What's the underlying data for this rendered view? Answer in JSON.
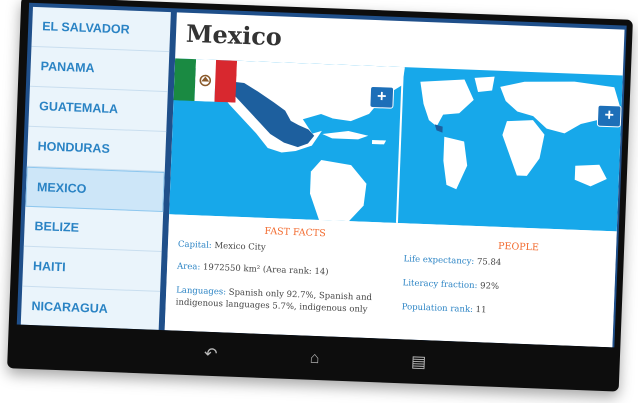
{
  "sidebar": {
    "items": [
      {
        "label": "EL SALVADOR"
      },
      {
        "label": "PANAMA"
      },
      {
        "label": "GUATEMALA"
      },
      {
        "label": "HONDURAS"
      },
      {
        "label": "MEXICO",
        "selected": true
      },
      {
        "label": "BELIZE"
      },
      {
        "label": "HAITI"
      },
      {
        "label": "NICARAGUA"
      }
    ]
  },
  "country": {
    "title": "Mexico",
    "fast_facts": {
      "heading": "FAST FACTS",
      "capital_label": "Capital:",
      "capital_value": "Mexico City",
      "area_label": "Area:",
      "area_value": "1972550 km² (Area rank: 14)",
      "languages_label": "Languages:",
      "languages_value": "Spanish only 92.7%, Spanish and indigenous languages 5.7%, indigenous only"
    },
    "people": {
      "heading": "PEOPLE",
      "life_label": "Life expectancy:",
      "life_value": "75.84",
      "literacy_label": "Literacy fraction:",
      "literacy_value": "92%",
      "population_label": "Population rank:",
      "population_value": "11"
    }
  },
  "icons": {
    "map_back": "back-arrow-icon",
    "zoom_left": "plus-icon",
    "zoom_right": "plus-icon",
    "nav_back": "back-icon",
    "nav_home": "home-icon",
    "nav_recents": "recents-icon"
  },
  "colors": {
    "accent": "#2a83c4",
    "ocean": "#17a8ea",
    "highlight_country": "#1d5f9e",
    "section_heading": "#f26a2e"
  }
}
